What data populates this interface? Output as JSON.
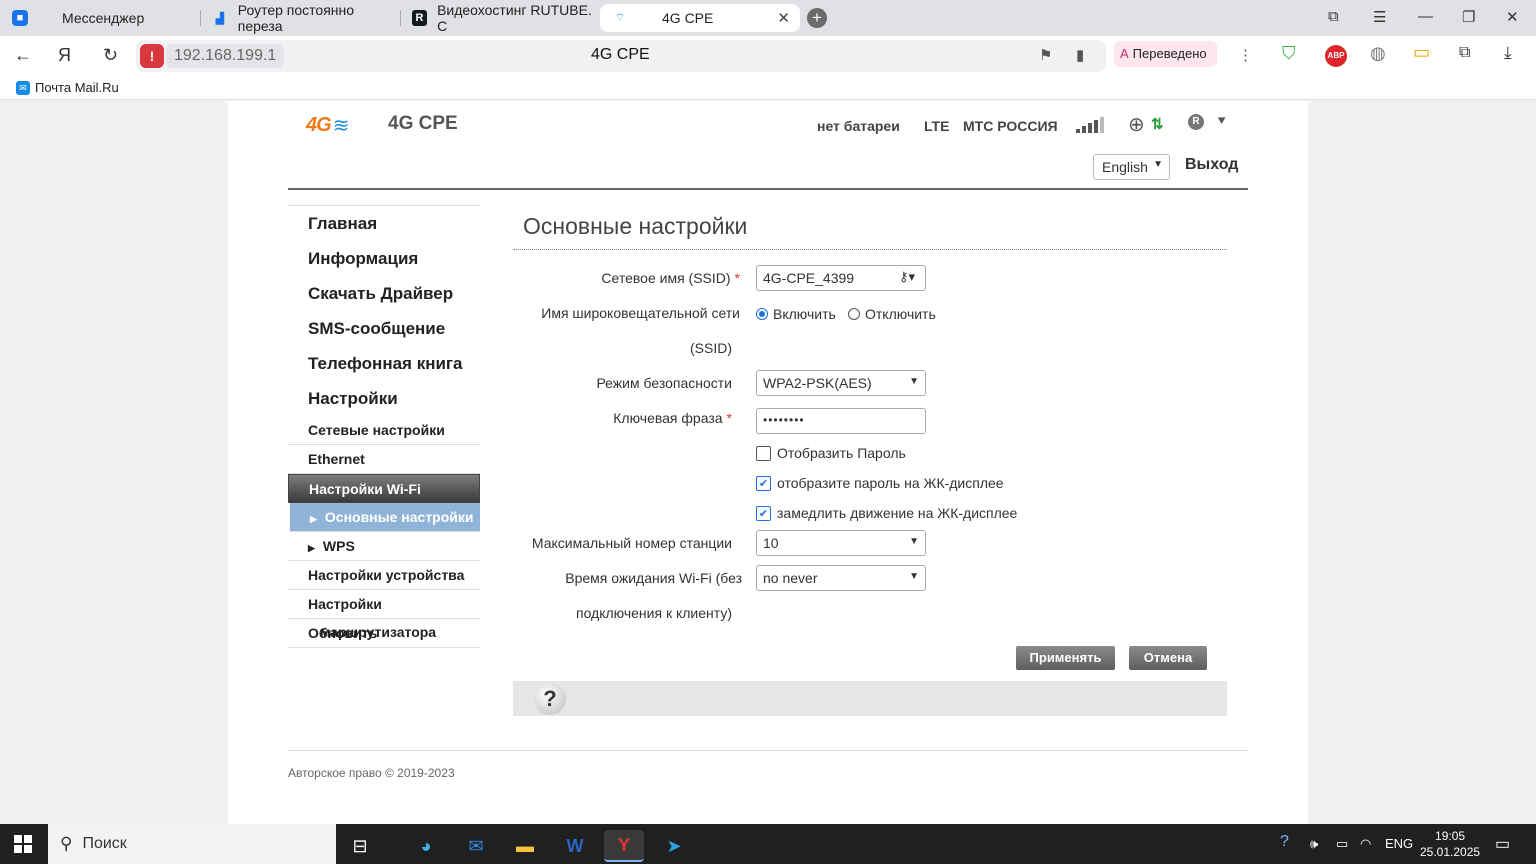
{
  "browser": {
    "tabs": [
      {
        "title": "Мессенджер",
        "icon": "messenger-icon"
      },
      {
        "title": "Роутер постоянно переза",
        "icon": "forum-icon"
      },
      {
        "title": "Видеохостинг RUTUBE. С",
        "icon": "rutube-icon"
      },
      {
        "title": "4G CPE",
        "icon": "wifi-icon"
      }
    ],
    "url": "192.168.199.1",
    "page_title": "4G CPE",
    "translated_label": "Переведено",
    "bookmark": "Почта Mail.Ru",
    "abp_label": "ABP"
  },
  "router": {
    "logo_4g": "4G",
    "brand": "4G CPE",
    "battery": "нет батареи",
    "network_type": "LTE",
    "operator": "МТС РОССИЯ",
    "roaming": "R",
    "language": "English",
    "logout": "Выход",
    "main_menu": [
      "Главная",
      "Информация",
      "Скачать Драйвер",
      "SMS-сообщение",
      "Телефонная книга",
      "Настройки"
    ],
    "sub_menu": [
      "Сетевые настройки",
      "Ethernet",
      "Настройки Wi-Fi"
    ],
    "wifi_sub": [
      "Основные настройки",
      "WPS"
    ],
    "sub_menu_after": [
      "Настройки устройства",
      "Настройки"
    ],
    "overlap_item_a": "Обновить",
    "overlap_item_b": "маршрутизатора"
  },
  "form": {
    "title": "Основные настройки",
    "ssid_label": "Сетевое имя (SSID)",
    "ssid_value": "4G-CPE_4399",
    "broadcast_label_1": "Имя широковещательной сети",
    "broadcast_label_2": "(SSID)",
    "enable_label": "Включить",
    "disable_label": "Отключить",
    "security_label": "Режим безопасности",
    "security_value": "WPA2-PSK(AES)",
    "passphrase_label": "Ключевая фраза",
    "passphrase_value": "••••••••",
    "show_password": "Отобразить Пароль",
    "show_lcd_password": "отобразите пароль на ЖК-дисплее",
    "slow_lcd": "замедлить движение на ЖК-дисплее",
    "max_station_label": "Максимальный номер станции",
    "max_station_value": "10",
    "timeout_label_1": "Время ожидания Wi-Fi (без",
    "timeout_label_2": "подключения к клиенту)",
    "timeout_value": "no never",
    "apply": "Применять",
    "cancel": "Отмена",
    "help": "?",
    "copyright": "Авторское право © 2019-2023"
  },
  "taskbar": {
    "search": "Поиск",
    "lang": "ENG",
    "time": "19:05",
    "date": "25.01.2025"
  },
  "colors": {
    "accent_orange": "#f07a1a",
    "wifi_blue": "#1e8ad6",
    "active_sub": "#8fb4d8"
  }
}
